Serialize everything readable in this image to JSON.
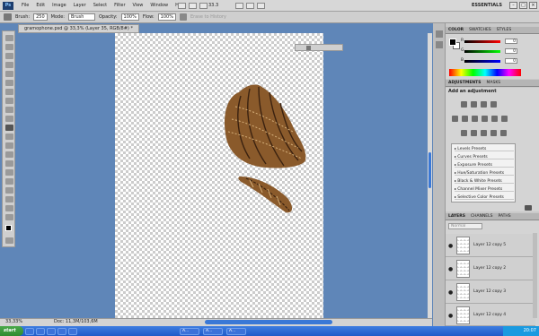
{
  "app": {
    "logo": "Ps",
    "zoom": "33.3",
    "workspace": "ESSENTIALS"
  },
  "menus": [
    "File",
    "Edit",
    "Image",
    "Layer",
    "Select",
    "Filter",
    "View",
    "Window",
    "Help"
  ],
  "options": {
    "brush_label": "Brush:",
    "brush_size": "250",
    "mode_label": "Mode:",
    "mode_value": "Brush",
    "opacity_label": "Opacity:",
    "opacity_value": "100%",
    "flow_label": "Flow:",
    "flow_value": "100%",
    "erase_history": "Erase to History"
  },
  "document": {
    "tab_title": "gramophone.psd @ 33,3% (Layer 35, RGB/8#) *",
    "zoom_status": "33,33%",
    "doc_size": "Doc: 11,3M/103,6M"
  },
  "color_panel": {
    "tabs": [
      "COLOR",
      "SWATCHES",
      "STYLES"
    ],
    "channels": [
      {
        "label": "R",
        "value": "0"
      },
      {
        "label": "G",
        "value": "0"
      },
      {
        "label": "B",
        "value": "0"
      }
    ]
  },
  "adjustments_panel": {
    "tabs": [
      "ADJUSTMENTS",
      "MASKS"
    ],
    "heading": "Add an adjustment",
    "presets": [
      "Levels Presets",
      "Curves Presets",
      "Exposure Presets",
      "Hue/Saturation Presets",
      "Black & White Presets",
      "Channel Mixer Presets",
      "Selective Color Presets"
    ]
  },
  "layers_panel": {
    "tabs": [
      "LAYERS",
      "CHANNELS",
      "PATHS"
    ],
    "blend_mode": "Normal",
    "layers": [
      {
        "name": "Layer 12 copy 5"
      },
      {
        "name": "Layer 12 copy 2"
      },
      {
        "name": "Layer 12 copy 3"
      },
      {
        "name": "Layer 12 copy 4"
      }
    ]
  },
  "taskbar": {
    "start": "start",
    "buttons": [
      "",
      "",
      "A...",
      "A...",
      "A..."
    ],
    "clock": "20:07"
  },
  "colors": {
    "canvas_bg": "#5f86b8",
    "accent": "#3a78d6",
    "feather": "#8a5a2b"
  }
}
